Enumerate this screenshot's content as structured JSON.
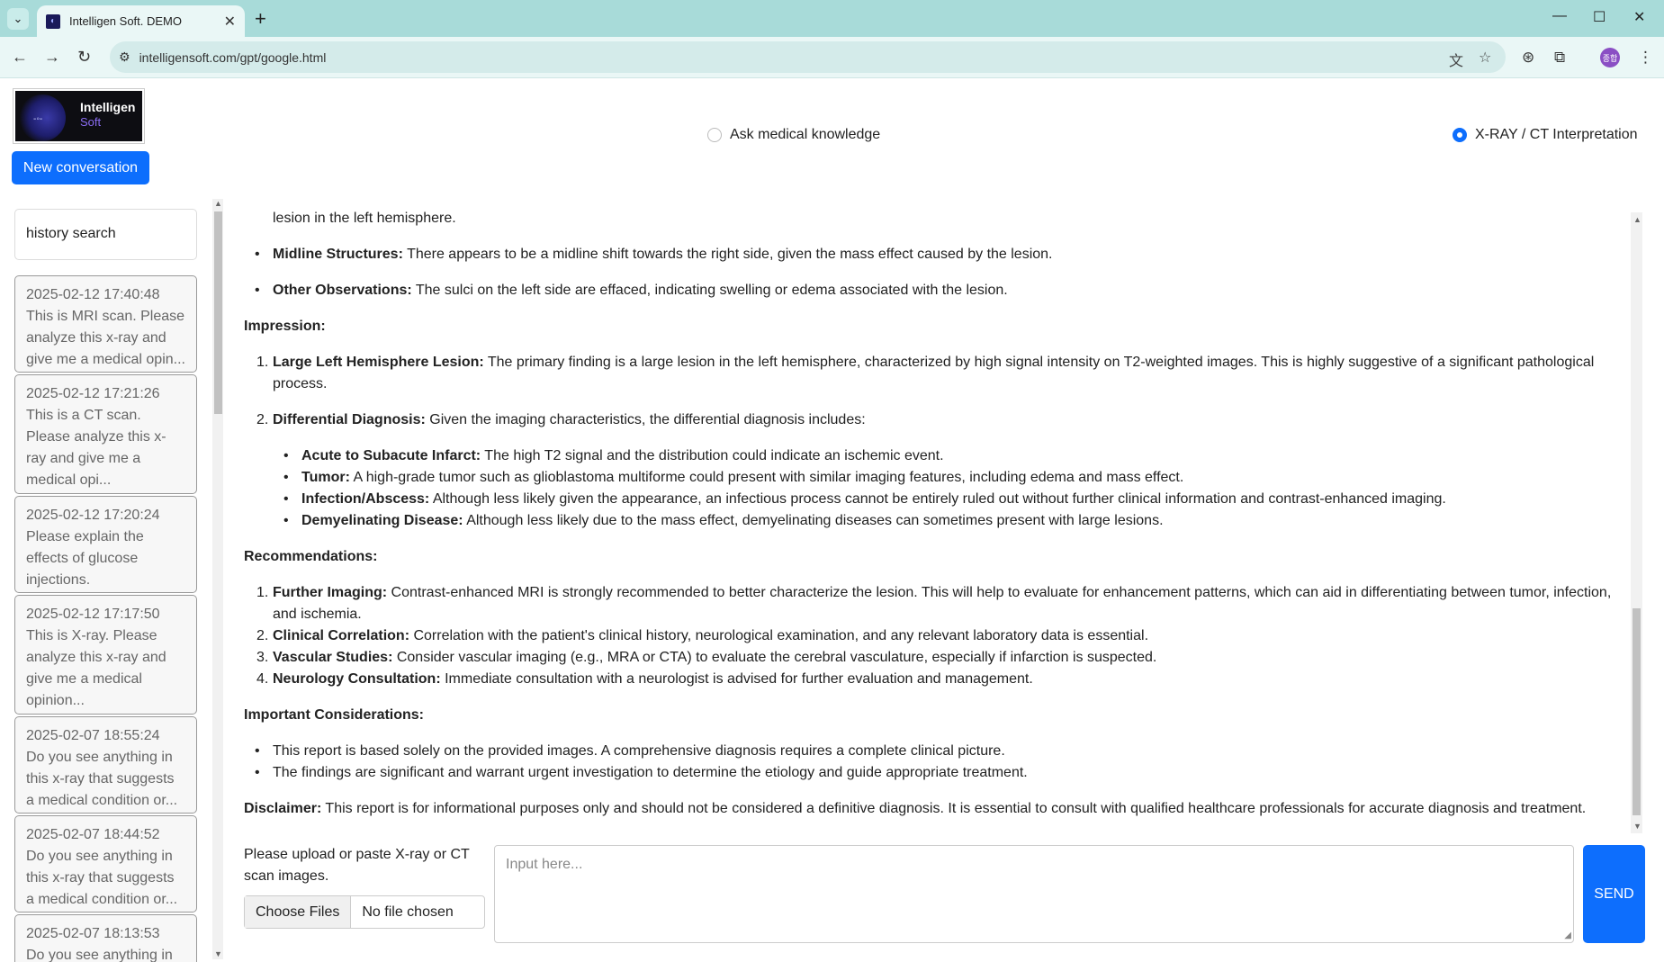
{
  "browser": {
    "tab_title": "Intelligen Soft. DEMO",
    "url": "intelligensoft.com/gpt/google.html",
    "icons": [
      "tab-list-icon",
      "close-icon",
      "new-tab-icon",
      "minimize-icon",
      "maximize-icon",
      "close-window-icon",
      "back-icon",
      "forward-icon",
      "reload-icon",
      "site-info-icon",
      "translate-icon",
      "star-icon",
      "extension-icon",
      "puzzle-icon",
      "menu-icon"
    ],
    "profile_initials": "종합"
  },
  "header": {
    "logo_line1": "Intelligen",
    "logo_line2": "Soft",
    "new_conversation": "New conversation",
    "mode_ask": "Ask medical knowledge",
    "mode_xray": "X-RAY / CT Interpretation"
  },
  "sidebar": {
    "search": "history search",
    "items": [
      {
        "date": "2025-02-12 17:40:48",
        "lines": [
          "This is MRI scan. Please",
          "analyze this x-ray and",
          "give me a medical opin..."
        ]
      },
      {
        "date": "2025-02-12 17:21:26",
        "lines": [
          "This is a CT scan.",
          "Please analyze this x-",
          "ray and give me a",
          "medical opi..."
        ]
      },
      {
        "date": "2025-02-12 17:20:24",
        "lines": [
          "Please explain the",
          "effects of glucose",
          "injections."
        ]
      },
      {
        "date": "2025-02-12 17:17:50",
        "lines": [
          "This is X-ray. Please",
          "analyze this x-ray and",
          "give me a medical",
          "opinion..."
        ]
      },
      {
        "date": "2025-02-07 18:55:24",
        "lines": [
          "Do you see anything in",
          "this x-ray that suggests",
          "a medical condition or..."
        ]
      },
      {
        "date": "2025-02-07 18:44:52",
        "lines": [
          "Do you see anything in",
          "this x-ray that suggests",
          "a medical condition or..."
        ]
      },
      {
        "date": "2025-02-07 18:13:53",
        "lines": [
          "Do you see anything in"
        ]
      }
    ]
  },
  "report": {
    "top_line": "lesion in the left hemisphere.",
    "midline_label": "Midline Structures:",
    "midline_text": " There appears to be a midline shift towards the right side, given the mass effect caused by the lesion.",
    "other_label": "Other Observations:",
    "other_text": " The sulci on the left side are effaced, indicating swelling or edema associated with the lesion.",
    "impression_title": "Impression:",
    "imp1_label": "Large Left Hemisphere Lesion:",
    "imp1_text": " The primary finding is a large lesion in the left hemisphere, characterized by high signal intensity on T2-weighted images. This is highly suggestive of a significant pathological",
    "imp1_text2": "process.",
    "imp2_label": "Differential Diagnosis:",
    "imp2_text": " Given the imaging characteristics, the differential diagnosis includes:",
    "diff": [
      {
        "label": "Acute to Subacute Infarct:",
        "text": " The high T2 signal and the distribution could indicate an ischemic event."
      },
      {
        "label": "Tumor:",
        "text": " A high-grade tumor such as glioblastoma multiforme could present with similar imaging features, including edema and mass effect."
      },
      {
        "label": "Infection/Abscess:",
        "text": " Although less likely given the appearance, an infectious process cannot be entirely ruled out without further clinical information and contrast-enhanced imaging."
      },
      {
        "label": "Demyelinating Disease:",
        "text": " Although less likely due to the mass effect, demyelinating diseases can sometimes present with large lesions."
      }
    ],
    "rec_title": "Recommendations:",
    "rec1_label": "Further Imaging:",
    "rec1_text": " Contrast-enhanced MRI is strongly recommended to better characterize the lesion. This will help to evaluate for enhancement patterns, which can aid in differentiating between tumor, infection,",
    "rec1_text2": "and ischemia.",
    "rec2_label": "Clinical Correlation:",
    "rec2_text": " Correlation with the patient's clinical history, neurological examination, and any relevant laboratory data is essential.",
    "rec3_label": "Vascular Studies:",
    "rec3_text": " Consider vascular imaging (e.g., MRA or CTA) to evaluate the cerebral vasculature, especially if infarction is suspected.",
    "rec4_label": "Neurology Consultation:",
    "rec4_text": " Immediate consultation with a neurologist is advised for further evaluation and management.",
    "cons_title": "Important Considerations:",
    "cons1": "This report is based solely on the provided images. A comprehensive diagnosis requires a complete clinical picture.",
    "cons2": "The findings are significant and warrant urgent investigation to determine the etiology and guide appropriate treatment.",
    "disc_label": "Disclaimer:",
    "disc_text": " This report is for informational purposes only and should not be considered a definitive diagnosis. It is essential to consult with qualified healthcare professionals for accurate diagnosis and treatment."
  },
  "input": {
    "upload_label": "Please upload or paste X-ray or CT scan images.",
    "choose_files": "Choose Files",
    "no_file": "No file chosen",
    "placeholder": "Input here...",
    "send": "SEND"
  }
}
